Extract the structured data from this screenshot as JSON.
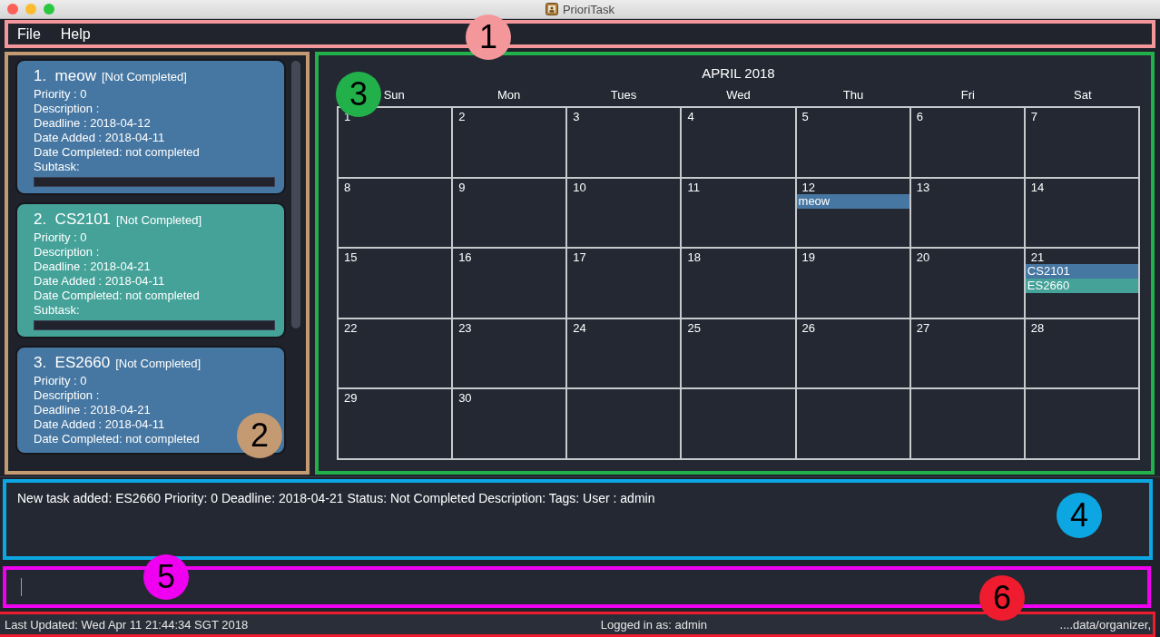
{
  "window": {
    "title": "PrioriTask"
  },
  "menu": [
    "File",
    "Help"
  ],
  "tasks": [
    {
      "number": "1.",
      "name": "meow",
      "status": "[Not Completed]",
      "color": "#4677a2",
      "lines": [
        "Priority : 0",
        "Description :",
        "Deadline : 2018-04-12",
        "Date Added : 2018-04-11",
        "Date Completed: not completed",
        "Subtask:"
      ]
    },
    {
      "number": "2.",
      "name": "CS2101",
      "status": "[Not Completed]",
      "color": "#44a299",
      "lines": [
        "Priority : 0",
        "Description :",
        "Deadline : 2018-04-21",
        "Date Added : 2018-04-11",
        "Date Completed: not completed",
        "Subtask:"
      ]
    },
    {
      "number": "3.",
      "name": "ES2660",
      "status": "[Not Completed]",
      "color": "#4677a2",
      "lines": [
        "Priority : 0",
        "Description :",
        "Deadline : 2018-04-21",
        "Date Added : 2018-04-11",
        "Date Completed: not completed"
      ]
    }
  ],
  "calendar": {
    "title": "APRIL 2018",
    "weekdays": [
      "Sun",
      "Mon",
      "Tues",
      "Wed",
      "Thu",
      "Fri",
      "Sat"
    ],
    "weeks": [
      [
        {
          "day": "1"
        },
        {
          "day": "2"
        },
        {
          "day": "3"
        },
        {
          "day": "4"
        },
        {
          "day": "5"
        },
        {
          "day": "6"
        },
        {
          "day": "7"
        }
      ],
      [
        {
          "day": "8"
        },
        {
          "day": "9"
        },
        {
          "day": "10"
        },
        {
          "day": "11"
        },
        {
          "day": "12",
          "events": [
            {
              "name": "meow",
              "color": "#4677a2"
            }
          ]
        },
        {
          "day": "13"
        },
        {
          "day": "14"
        }
      ],
      [
        {
          "day": "15"
        },
        {
          "day": "16"
        },
        {
          "day": "17"
        },
        {
          "day": "18"
        },
        {
          "day": "19"
        },
        {
          "day": "20"
        },
        {
          "day": "21",
          "events": [
            {
              "name": "CS2101",
              "color": "#4677a2"
            },
            {
              "name": "ES2660",
              "color": "#44a299"
            }
          ]
        }
      ],
      [
        {
          "day": "22"
        },
        {
          "day": "23"
        },
        {
          "day": "24"
        },
        {
          "day": "25"
        },
        {
          "day": "26"
        },
        {
          "day": "27"
        },
        {
          "day": "28"
        }
      ],
      [
        {
          "day": "29"
        },
        {
          "day": "30"
        }
      ]
    ]
  },
  "result": "New task added: ES2660 Priority: 0 Deadline: 2018-04-21 Status: Not Completed Description:  Tags:  User : admin",
  "status_bar": {
    "left": "Last Updated: Wed Apr 11 21:44:34 SGT 2018",
    "center": "Logged in as: admin",
    "right": "....data/organizer,"
  },
  "annotations": [
    {
      "label": "1",
      "color": "#f4979b"
    },
    {
      "label": "2",
      "color": "#c49a72"
    },
    {
      "label": "3",
      "color": "#22b04b"
    },
    {
      "label": "4",
      "color": "#0ca7e2"
    },
    {
      "label": "5",
      "color": "#f000f0"
    },
    {
      "label": "6",
      "color": "#ee1c2e"
    }
  ]
}
